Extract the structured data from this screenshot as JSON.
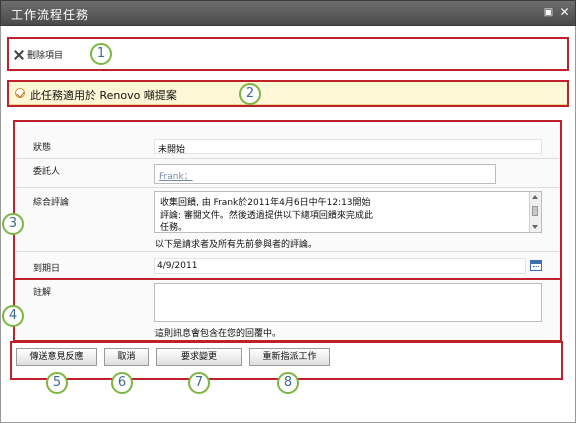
{
  "window": {
    "title": "工作流程任務"
  },
  "ribbon": {
    "delete_label": "刪除項目"
  },
  "infobar": {
    "text": "此任務適用於 Renovo 噸提案"
  },
  "form": {
    "status_label": "狀態",
    "status_value": "未開始",
    "assignee_label": "委託人",
    "assignee_value": "Frank；",
    "comments_label": "綜合評論",
    "comments_lines": [
      "收集回饋, 由 Frank於2011年4月6日中午12:13開始",
      "評論: 審閱文件。然後透過提供以下總項回饋來完成此",
      "任務。"
    ],
    "comments_note": "以下是請求者及所有先前參與者的評論。",
    "due_label": "到期日",
    "due_value": "4/9/2011",
    "notes_label": "註解",
    "notes_hint": "這則訊息會包含在您的回覆中。"
  },
  "buttons": {
    "send_feedback": "傳送意見反應",
    "cancel": "取消",
    "request_change": "要求變更",
    "reassign": "重新指派工作"
  },
  "callouts": [
    "1",
    "2",
    "3",
    "4",
    "5",
    "6",
    "7",
    "8"
  ],
  "colors": {
    "callout_border": "#c0202a",
    "callout_circle": "#7cb640",
    "infobar_bg": "#fff7d6"
  }
}
